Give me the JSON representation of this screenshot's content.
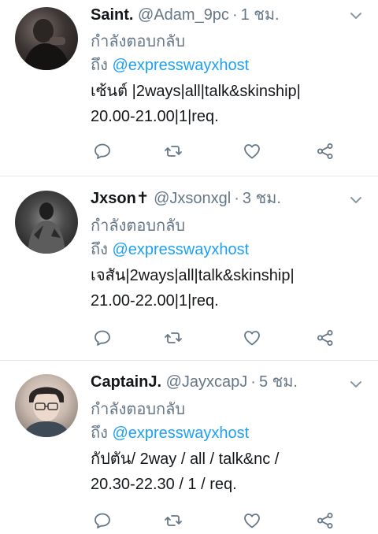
{
  "tweets": [
    {
      "name": "Saint.",
      "handle": "@Adam_9pc",
      "separator": "·",
      "time": "1 ชม.",
      "replying_label": "กำลังตอบกลับ",
      "to_label": "ถึง",
      "mention": "@expresswayxhost",
      "lines": [
        "เซ้นต์ |2ways|all|talk&skinship|",
        "20.00-21.00|1|req."
      ]
    },
    {
      "name": "Jxson✝",
      "handle": "@Jxsonxgl",
      "separator": "·",
      "time": "3 ชม.",
      "replying_label": "กำลังตอบกลับ",
      "to_label": "ถึง",
      "mention": "@expresswayxhost",
      "lines": [
        "เจสัน|2ways|all|talk&skinship|",
        "21.00-22.00|1|req."
      ]
    },
    {
      "name": "CaptainJ.",
      "handle": "@JayxcapJ",
      "separator": "·",
      "time": "5 ชม.",
      "replying_label": "กำลังตอบกลับ",
      "to_label": "ถึง",
      "mention": "@expresswayxhost",
      "lines": [
        "กัปตัน/ 2way / all / talk&nc /",
        "20.30-22.30 / 1 / req."
      ]
    }
  ],
  "icons": {
    "reply": "reply-icon",
    "retweet": "retweet-icon",
    "like": "heart-icon",
    "share": "share-icon",
    "menu": "chevron-down-icon"
  },
  "colors": {
    "text": "#14171a",
    "secondary": "#657786",
    "link": "#1da1f2",
    "icon": "#657786",
    "divider": "#e1e8ed"
  }
}
